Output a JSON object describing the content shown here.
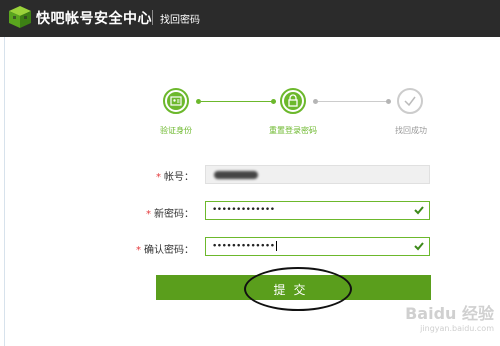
{
  "header": {
    "brand": "快吧帐号安全中心",
    "subtitle": "找回密码"
  },
  "steps": [
    {
      "label": "验证身份",
      "state": "done",
      "icon": "id-card-icon"
    },
    {
      "label": "重置登录密码",
      "state": "current",
      "icon": "lock-icon"
    },
    {
      "label": "找回成功",
      "state": "todo",
      "icon": "check-icon"
    }
  ],
  "form": {
    "account_label": "帐号：",
    "account_value": "",
    "new_password_label": "新密码：",
    "new_password_value": "•••••••••••••",
    "confirm_password_label": "确认密码：",
    "confirm_password_value": "•••••••••••••",
    "required_mark": "*",
    "submit_label": "提交"
  },
  "watermark": {
    "line1": "Baidu 经验",
    "line2": "jingyan.baidu.com"
  },
  "colors": {
    "header_bg": "#2b2b2b",
    "accent_green": "#6cb82c",
    "button_green": "#5a9e1c",
    "required_red": "#e4393c"
  }
}
